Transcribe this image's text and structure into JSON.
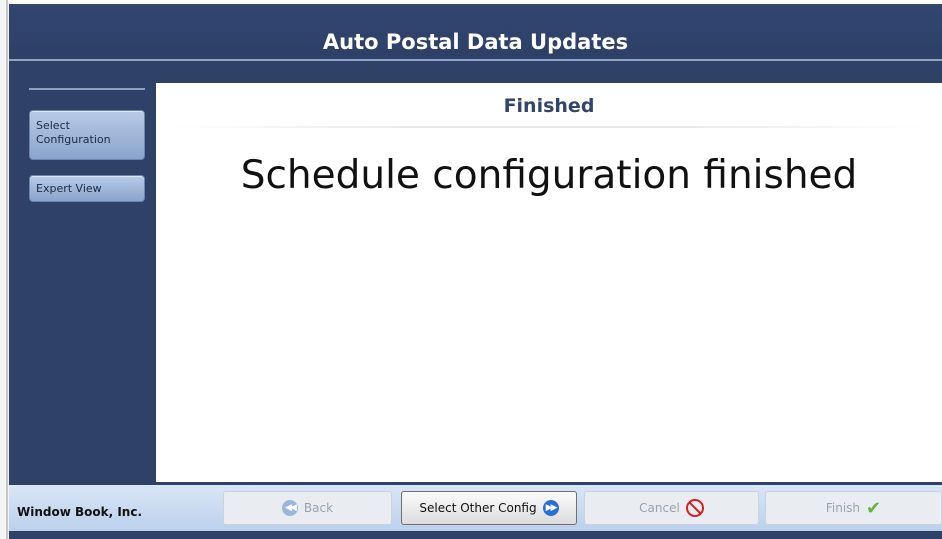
{
  "window": {
    "title": "Auto Postal Data Updates"
  },
  "sidebar": {
    "items": [
      {
        "label": "Select Configuration"
      },
      {
        "label": "Expert View"
      }
    ]
  },
  "content": {
    "step_title": "Finished",
    "message": "Schedule configuration finished"
  },
  "footer": {
    "company": "Window Book, Inc.",
    "buttons": {
      "back": "Back",
      "select_other_config": "Select Other Config",
      "cancel": "Cancel",
      "finish": "Finish"
    }
  },
  "icons": {
    "back": "back-arrow-icon",
    "forward": "forward-arrow-icon",
    "cancel": "cancel-circle-icon",
    "finish": "checkmark-icon"
  },
  "colors": {
    "window_bg": "#2f4166",
    "title_text": "#ffffff",
    "step_title": "#34456a",
    "forward_icon": "#2a6fd6",
    "cancel_icon": "#d61f1f",
    "check_icon": "#67b53a"
  }
}
